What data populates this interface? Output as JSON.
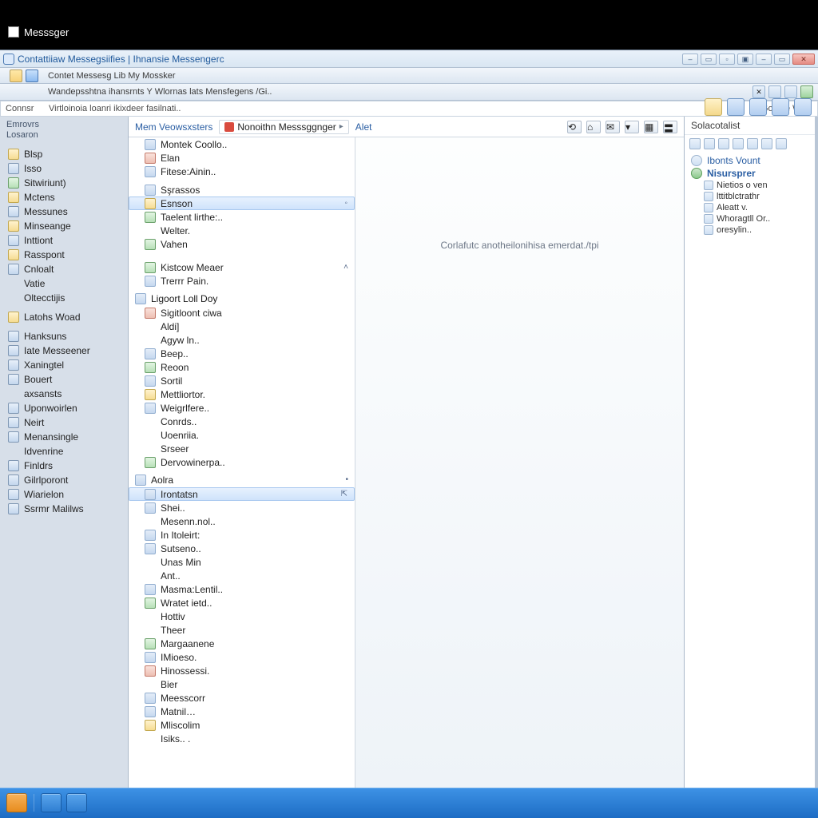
{
  "app": {
    "title": "Messsger"
  },
  "window": {
    "head_title": "Contattiiaw Messegsiifies | Ihnansie Messengerc",
    "tab1": "Contet Messesg Lib My Mossker",
    "tab2": "Wandepsshtna ihansrnts Y Wlornas lats Mensfegens /Gi..",
    "addr_left": "Connsr",
    "addr_text": "Virtloinoia loanri ikixdeer fasilnati..",
    "addr_mid": "Gocere Wel.."
  },
  "left": {
    "h1": "Emrovrs",
    "h2": "Losaron",
    "items": [
      {
        "label": "Blsp",
        "ico": "y"
      },
      {
        "label": "Isso",
        "ico": ""
      },
      {
        "label": "Sitwiriunt)",
        "ico": "g"
      },
      {
        "label": "Mctens",
        "ico": "y"
      },
      {
        "label": "Messunes",
        "ico": ""
      },
      {
        "label": "Minseange",
        "ico": "y"
      },
      {
        "label": "Inttiont",
        "ico": ""
      },
      {
        "label": "Rasspont",
        "ico": "y"
      },
      {
        "label": "Cnloalt",
        "ico": ""
      },
      {
        "label": "Vatie",
        "ico": "none"
      },
      {
        "label": "Oltecctijis",
        "ico": "none"
      },
      {
        "label": "Latohs Woad",
        "ico": "y",
        "gap": true
      },
      {
        "label": "Hanksuns",
        "ico": "",
        "gap": true
      },
      {
        "label": "Iate Messeener",
        "ico": ""
      },
      {
        "label": "Xaningtel",
        "ico": ""
      },
      {
        "label": "Bouert",
        "ico": ""
      },
      {
        "label": "axsansts",
        "ico": "none"
      },
      {
        "label": "Uponwoirlen",
        "ico": ""
      },
      {
        "label": "Neirt",
        "ico": ""
      },
      {
        "label": "Menansingle",
        "ico": ""
      },
      {
        "label": "Idvenrine",
        "ico": "none"
      },
      {
        "label": "Finldrs",
        "ico": ""
      },
      {
        "label": "Gilrlporont",
        "ico": ""
      },
      {
        "label": "Wiarielon",
        "ico": ""
      },
      {
        "label": "Ssrmr Malilws",
        "ico": ""
      }
    ]
  },
  "center": {
    "head_link": "Mem Veowsxsters",
    "chip_label": "Nonoithn Messsggnger",
    "chip_link": "Alet",
    "groups": [
      {
        "items": [
          {
            "label": "Montek Coollo..",
            "ico": ""
          },
          {
            "label": "Elan",
            "ico": "r"
          },
          {
            "label": "Fitese:Ainin..",
            "ico": ""
          },
          {
            "label": "Sşrassos",
            "ico": "",
            "gap": true
          },
          {
            "label": "Esnson",
            "ico": "y",
            "hl": true,
            "dot": true
          },
          {
            "label": "Taelent lirthe:..",
            "ico": "g"
          },
          {
            "label": "Welter.",
            "ico": "none"
          },
          {
            "label": "Vahen",
            "ico": "g"
          }
        ]
      },
      {
        "title": "",
        "caretUp": true,
        "items": [
          {
            "label": "Kistcow Meaer",
            "ico": "g"
          },
          {
            "label": "Trerrr Pain.",
            "ico": ""
          }
        ]
      },
      {
        "items": [
          {
            "label": "Ligoort Loll Doy",
            "ico": "",
            "group": true
          },
          {
            "label": "Sigitloont ciwa",
            "ico": "r"
          },
          {
            "label": "Aldi]",
            "ico": "none"
          },
          {
            "label": "Agyw ln..",
            "ico": "none"
          },
          {
            "label": "Beep..",
            "ico": ""
          },
          {
            "label": "Reoon",
            "ico": "g"
          },
          {
            "label": "Sortil",
            "ico": ""
          },
          {
            "label": "Mettliortor.",
            "ico": "y"
          },
          {
            "label": "Weigrlfere..",
            "ico": ""
          },
          {
            "label": "Conrds..",
            "ico": "none"
          },
          {
            "label": "Uoenriia.",
            "ico": "none"
          },
          {
            "label": "Srseer",
            "ico": "none"
          },
          {
            "label": "Dervowinerpa..",
            "ico": "g"
          }
        ]
      },
      {
        "items": [
          {
            "label": "Aolra",
            "ico": "",
            "group": true,
            "caret": true
          },
          {
            "label": "Irontatsn",
            "ico": "",
            "hl": true,
            "pin": true
          },
          {
            "label": "Shei..",
            "ico": ""
          },
          {
            "label": "Mesenn.nol..",
            "ico": "none"
          },
          {
            "label": "In Itoleirt:",
            "ico": ""
          },
          {
            "label": "Sutseno..",
            "ico": ""
          },
          {
            "label": "Unas Min",
            "ico": "none"
          },
          {
            "label": "Ant..",
            "ico": "none"
          },
          {
            "label": "Masma:Lentil..",
            "ico": ""
          },
          {
            "label": "Wratet ietd..",
            "ico": "g"
          },
          {
            "label": "Hottiv",
            "ico": "none"
          },
          {
            "label": "Theer",
            "ico": "none"
          },
          {
            "label": "Margaanene",
            "ico": "g"
          },
          {
            "label": "IMioeso.",
            "ico": ""
          },
          {
            "label": "Hinossessi.",
            "ico": "r"
          },
          {
            "label": "Bier",
            "ico": "none"
          },
          {
            "label": "Meesscorr",
            "ico": ""
          },
          {
            "label": "Matnil…",
            "ico": ""
          },
          {
            "label": "Mliscolim",
            "ico": "y"
          },
          {
            "label": "Isiks.. .",
            "ico": "none"
          }
        ]
      }
    ],
    "placeholder": "Corlafutc anotheilonihisa emerdat./tpi"
  },
  "right": {
    "title": "Solacotalist",
    "link1": "Ibonts Vount",
    "link2": "Nisursprer",
    "sub": [
      "Nietios o ven",
      "lttitblctrathr",
      "Aleatt v.",
      "Whoragtll Or..",
      "oresylin.."
    ]
  }
}
